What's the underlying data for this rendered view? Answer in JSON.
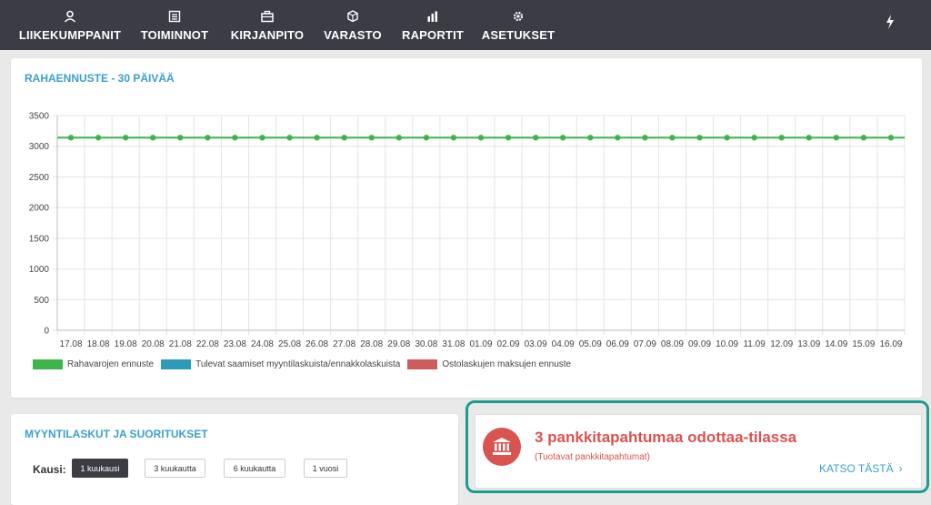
{
  "nav": {
    "items": [
      {
        "label": "LIIKEKUMPPANIT",
        "icon": "user-icon"
      },
      {
        "label": "TOIMINNOT",
        "icon": "list-icon"
      },
      {
        "label": "KIRJANPITO",
        "icon": "briefcase-icon"
      },
      {
        "label": "VARASTO",
        "icon": "boxes-icon"
      },
      {
        "label": "RAPORTIT",
        "icon": "bar-chart-icon"
      },
      {
        "label": "ASETUKSET",
        "icon": "gear-icon"
      }
    ],
    "quick_icon": "lightning-icon"
  },
  "forecast": {
    "title": "RAHAENNUSTE - 30 PÄIVÄÄ"
  },
  "chart_data": {
    "type": "line",
    "title": "RAHAENNUSTE - 30 PÄIVÄÄ",
    "x": [
      "17.08",
      "18.08",
      "19.08",
      "20.08",
      "21.08",
      "22.08",
      "23.08",
      "24.08",
      "25.08",
      "26.08",
      "27.08",
      "28.08",
      "29.08",
      "30.08",
      "31.08",
      "01.09",
      "02.09",
      "03.09",
      "04.09",
      "05.09",
      "06.09",
      "07.09",
      "08.09",
      "09.09",
      "10.09",
      "11.09",
      "12.09",
      "13.09",
      "14.09",
      "15.09",
      "16.09"
    ],
    "y_ticks": [
      0,
      500,
      1000,
      1500,
      2000,
      2500,
      3000,
      3500
    ],
    "ylim": [
      0,
      3500
    ],
    "grid": true,
    "legend_position": "bottom-left",
    "series": [
      {
        "name": "Rahavarojen ennuste",
        "color": "#3cb54a",
        "values": [
          3140,
          3140,
          3140,
          3140,
          3140,
          3140,
          3140,
          3140,
          3140,
          3140,
          3140,
          3140,
          3140,
          3140,
          3140,
          3140,
          3140,
          3140,
          3140,
          3140,
          3140,
          3140,
          3140,
          3140,
          3140,
          3140,
          3140,
          3140,
          3140,
          3140,
          3140
        ]
      },
      {
        "name": "Tulevat saamiset myyntilaskuista/ennakkolaskuista",
        "color": "#2e9ab8",
        "values": []
      },
      {
        "name": "Ostolaskujen maksujen ennuste",
        "color": "#cd5c5c",
        "values": []
      }
    ]
  },
  "sales": {
    "title": "MYYNTILASKUT JA SUORITUKSET",
    "period_label": "Kausi:",
    "periods": [
      "1 kuukausi",
      "3 kuukautta",
      "6 kuukautta",
      "1 vuosi"
    ],
    "active_period": "1 kuukausi"
  },
  "notice": {
    "icon": "bank-icon",
    "title": "3 pankkitapahtumaa odottaa-tilassa",
    "subtitle": "(Tuotavat pankkitapahtumat)",
    "link": "KATSO TÄSTÄ",
    "color": "#d9534f"
  }
}
